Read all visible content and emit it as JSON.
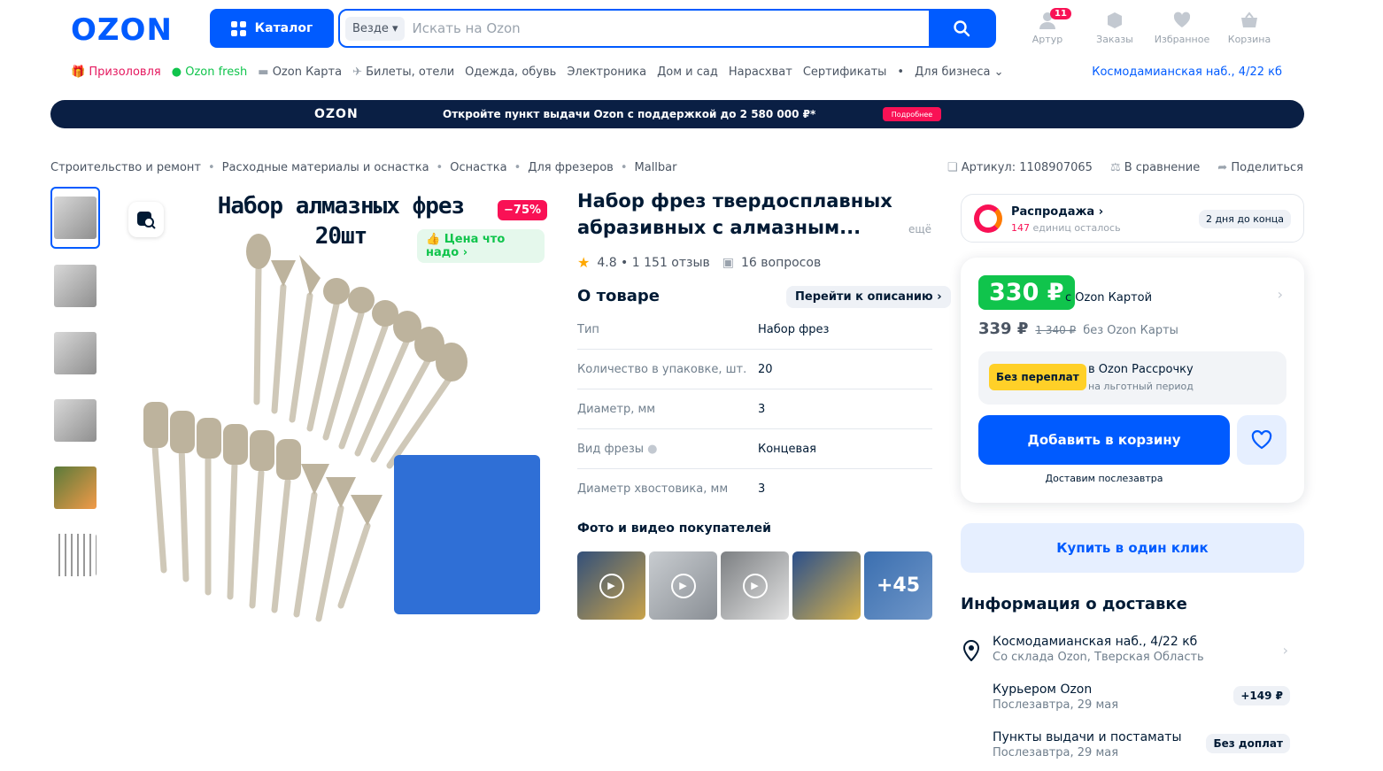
{
  "header": {
    "logo": "OZON",
    "catalog_label": "Каталог",
    "search_scope": "Везде ▾",
    "search_placeholder": "Искать на Ozon",
    "user_label": "Артур",
    "user_badge": "11",
    "orders_label": "Заказы",
    "favorites_label": "Избранное",
    "cart_label": "Корзина"
  },
  "subnav": {
    "items": [
      "Призоловля",
      "Ozon fresh",
      "Ozon Карта",
      "Билеты, отели",
      "Одежда, обувь",
      "Электроника",
      "Дом и сад",
      "Нарасхват",
      "Сертификаты",
      "•",
      "Для бизнеса ⌄"
    ],
    "address": "Космодамианская наб., 4/22 кб"
  },
  "banner": {
    "logo": "OZON",
    "text": "Откройте пункт выдачи Ozon с поддержкой до 2 580 000 ₽*",
    "button": "Подробнее"
  },
  "breadcrumbs": [
    "Строительство и ремонт",
    "Расходные материалы и оснастка",
    "Оснастка",
    "Для фрезеров",
    "Mallbar"
  ],
  "actions": {
    "article": "Артикул: 1108907065",
    "compare": "В сравнение",
    "share": "Поделиться"
  },
  "image": {
    "title_line1": "Набор алмазных фрез",
    "title_line2": "20шт",
    "discount": "−75%",
    "good_price": "👍 Цена что надо ›"
  },
  "product": {
    "title": "Набор фрез твердосплавных абразивных с алмазным...",
    "more": "ещё",
    "rating": "4.8 • 1 151 отзыв",
    "questions": "16 вопросов",
    "about": "О товаре",
    "to_description": "Перейти к описанию ›",
    "specs": [
      {
        "k": "Тип",
        "v": "Набор фрез"
      },
      {
        "k": "Количество в упаковке, шт.",
        "v": "20"
      },
      {
        "k": "Диаметр, мм",
        "v": "3"
      },
      {
        "k": "Вид фрезы",
        "v": "Концевая"
      },
      {
        "k": "Диаметр хвостовика, мм",
        "v": "3"
      }
    ],
    "photos_title": "Фото и видео покупателей",
    "photos_more": "+45"
  },
  "sale": {
    "title": "Распродажа ›",
    "count": "147",
    "count_text": " единиц осталось",
    "days": "2 дня до конца"
  },
  "price": {
    "card_price": "330 ₽",
    "card_label": "с Ozon Картой",
    "regular": "339 ₽",
    "old": "1 340 ₽",
    "without": "без Ozon Карты",
    "installment_tag": "Без переплат",
    "installment_a": "в Ozon Рассрочку",
    "installment_b": "на льготный период",
    "add_to_cart": "Добавить в корзину",
    "deliver": "Доставим послезавтра",
    "one_click": "Купить в один клик"
  },
  "delivery": {
    "title": "Информация о доставке",
    "rows": [
      {
        "a": "Космодамианская наб., 4/22 кб",
        "b": "Со склада Ozon, Тверская Область",
        "pill": ""
      },
      {
        "a": "Курьером Ozon",
        "b": "Послезавтра, 29 мая",
        "pill": "+149 ₽"
      },
      {
        "a": "Пункты выдачи и постаматы",
        "b": "Послезавтра, 29 мая",
        "pill": "Без доплат"
      }
    ]
  },
  "colors": {
    "brand": "#005bff",
    "sale": "#f91155",
    "green": "#10c44c"
  }
}
